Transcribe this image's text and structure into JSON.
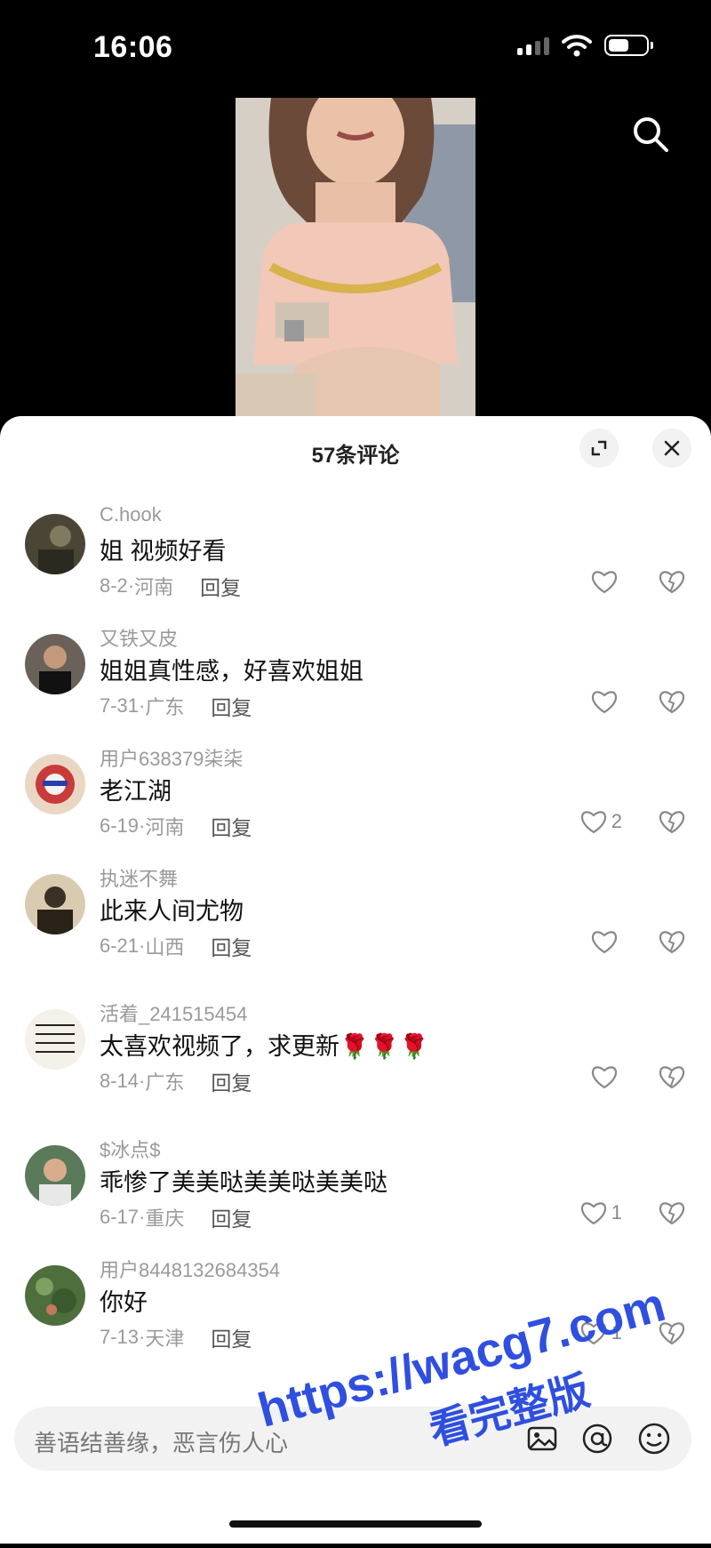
{
  "status": {
    "time": "16:06"
  },
  "comments_panel": {
    "count_label": "57条评论",
    "comments": [
      {
        "user": "C.hook",
        "text": "姐  视频好看",
        "date": "8-2",
        "region": "河南",
        "reply": "回复",
        "likes": ""
      },
      {
        "user": "又铁又皮",
        "text": "姐姐真性感，好喜欢姐姐",
        "date": "7-31",
        "region": "广东",
        "reply": "回复",
        "likes": ""
      },
      {
        "user": "用户638379柒柒",
        "text": "老江湖",
        "date": "6-19",
        "region": "河南",
        "reply": "回复",
        "likes": "2"
      },
      {
        "user": "执迷不舞",
        "text": "此来人间尤物",
        "date": "6-21",
        "region": "山西",
        "reply": "回复",
        "likes": ""
      },
      {
        "user": "活着_241515454",
        "text": "太喜欢视频了，求更新🌹🌹🌹",
        "date": "8-14",
        "region": "广东",
        "reply": "回复",
        "likes": ""
      },
      {
        "user": "$冰点$",
        "text": "乖惨了美美哒美美哒美美哒",
        "date": "6-17",
        "region": "重庆",
        "reply": "回复",
        "likes": "1"
      },
      {
        "user": "用户8448132684354",
        "text": "你好",
        "date": "7-13",
        "region": "天津",
        "reply": "回复",
        "likes": "1"
      }
    ]
  },
  "input": {
    "placeholder": "善语结善缘，恶言伤人心"
  },
  "watermark": {
    "line1": "https://wacg7.com",
    "line2": "看完整版"
  },
  "colors": {
    "watermark": "#2f4fe0",
    "sheet_bg": "#ffffff",
    "muted_text": "#9a9a9a"
  }
}
